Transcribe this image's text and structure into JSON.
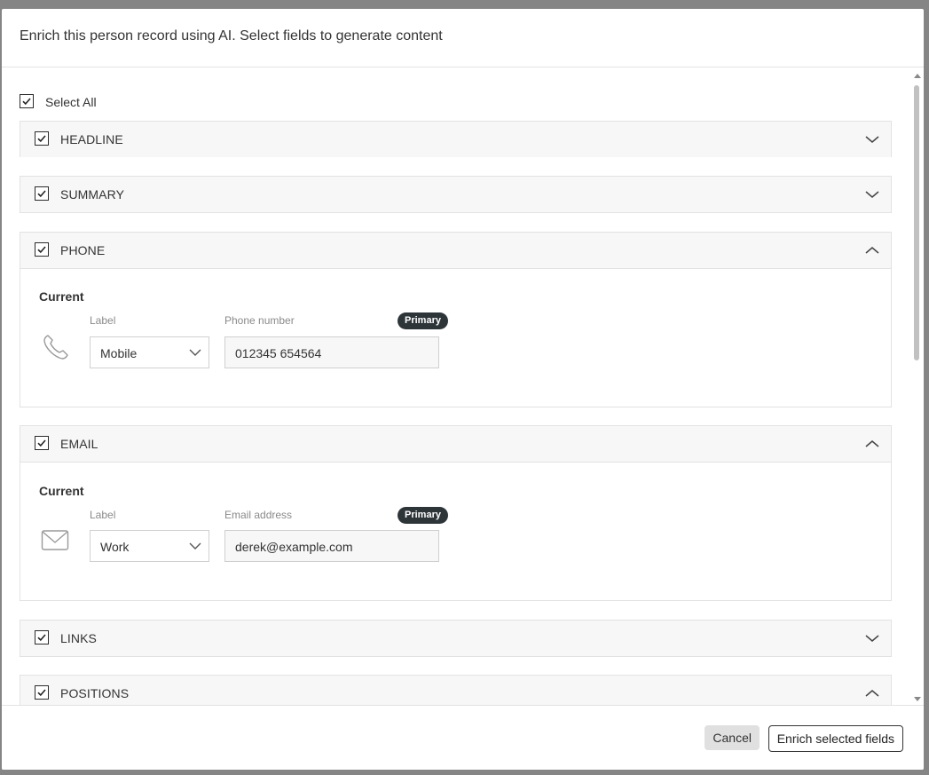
{
  "dialog": {
    "title": "Enrich this person record using AI. Select fields to generate content",
    "select_all_label": "Select All"
  },
  "sections": [
    {
      "label": "HEADLINE",
      "checked": true,
      "expanded": false
    },
    {
      "label": "SUMMARY",
      "checked": true,
      "expanded": false
    },
    {
      "label": "PHONE",
      "checked": true,
      "expanded": true
    },
    {
      "label": "EMAIL",
      "checked": true,
      "expanded": true
    },
    {
      "label": "LINKS",
      "checked": true,
      "expanded": false
    },
    {
      "label": "POSITIONS",
      "checked": true,
      "expanded": true
    }
  ],
  "phone": {
    "current_label": "Current",
    "label_caption": "Label",
    "label_value": "Mobile",
    "number_caption": "Phone number",
    "number_value": "012345 654564",
    "badge": "Primary",
    "icon": "phone-icon"
  },
  "email": {
    "current_label": "Current",
    "label_caption": "Label",
    "label_value": "Work",
    "address_caption": "Email address",
    "address_value": "derek@example.com",
    "badge": "Primary",
    "icon": "envelope-icon"
  },
  "footer": {
    "cancel_label": "Cancel",
    "enrich_label": "Enrich selected fields"
  },
  "colors": {
    "badge_bg": "#2d3539",
    "section_head_bg": "#f7f7f7",
    "overlay": "#858585"
  }
}
